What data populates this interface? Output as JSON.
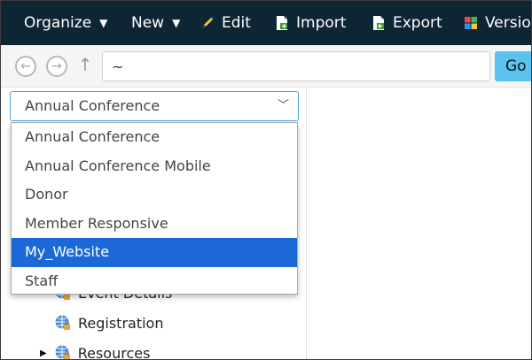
{
  "toolbar": {
    "organize_label": "Organize",
    "new_label": "New",
    "edit_label": "Edit",
    "import_label": "Import",
    "export_label": "Export",
    "versions_label": "Versio"
  },
  "address_bar": {
    "path_value": "~",
    "go_label": "Go"
  },
  "site_selector": {
    "selected_value": "Annual Conference",
    "options": [
      {
        "label": "Annual Conference",
        "selected": false
      },
      {
        "label": "Annual Conference Mobile",
        "selected": false
      },
      {
        "label": "Donor",
        "selected": false
      },
      {
        "label": "Member Responsive",
        "selected": false
      },
      {
        "label": "My_Website",
        "selected": true
      },
      {
        "label": "Staff",
        "selected": false
      }
    ]
  },
  "tree": {
    "event_details": "Event Details",
    "registration": "Registration",
    "resources": "Resources"
  },
  "colors": {
    "toolbar_bg": "#0e2533",
    "go_button": "#5cc2f0",
    "selected_option": "#1a69d6"
  }
}
